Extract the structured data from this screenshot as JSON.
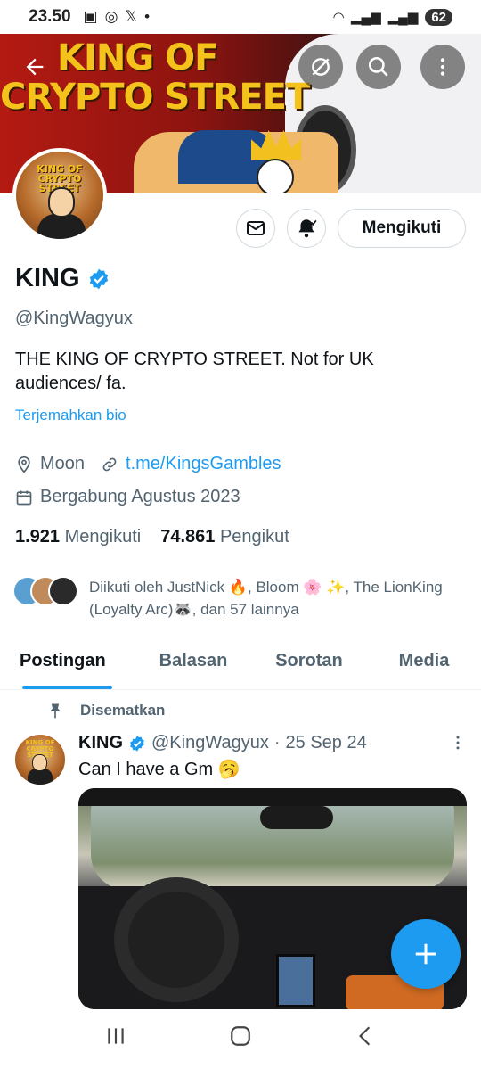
{
  "status_bar": {
    "time": "23.50",
    "battery": "62"
  },
  "banner": {
    "line1": "KING OF",
    "line2": "CRYPTO STREET"
  },
  "avatar": {
    "title": "KING OF CRYPTO STREET"
  },
  "profile": {
    "name": "KING",
    "handle": "@KingWagyux",
    "bio": "THE KING OF CRYPTO STREET. Not for UK audiences/ fa.",
    "translate_label": "Terjemahkan bio",
    "location": "Moon",
    "link": "t.me/KingsGambles",
    "joined": "Bergabung Agustus 2023",
    "following_count": "1.921",
    "following_label": "Mengikuti",
    "followers_count": "74.861",
    "followers_label": "Pengikut",
    "followed_by": "Diikuti oleh JustNick 🔥, Bloom 🌸 ✨, The LionKing (Loyalty Arc)🦝, dan 57 lainnya"
  },
  "actions": {
    "follow_label": "Mengikuti"
  },
  "tabs": [
    {
      "label": "Postingan",
      "active": true
    },
    {
      "label": "Balasan",
      "active": false
    },
    {
      "label": "Sorotan",
      "active": false
    },
    {
      "label": "Media",
      "active": false
    }
  ],
  "post": {
    "pinned_label": "Disematkan",
    "author_name": "KING",
    "author_handle": "@KingWagyux",
    "separator": "·",
    "date": "25 Sep 24",
    "text": "Can I have a Gm 🥱"
  },
  "colors": {
    "accent": "#1d9bf0",
    "muted": "#536471",
    "text": "#0f1419"
  }
}
